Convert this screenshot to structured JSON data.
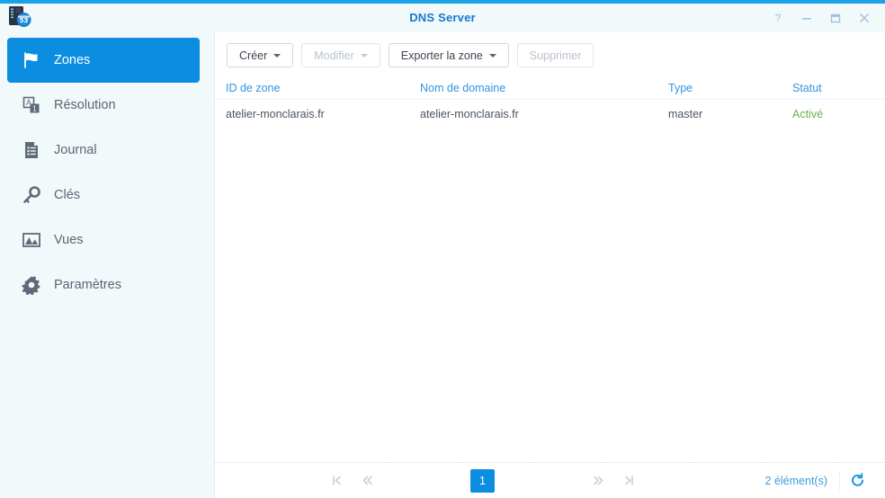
{
  "window": {
    "title": "DNS Server",
    "app_icon": "dns-server-icon",
    "accent_color": "#1ba1e6",
    "controls": [
      {
        "name": "help-button",
        "glyph": "?"
      },
      {
        "name": "minimize-button",
        "glyph": "minimize-icon"
      },
      {
        "name": "maximize-button",
        "glyph": "maximize-icon"
      },
      {
        "name": "close-button",
        "glyph": "close-icon"
      }
    ]
  },
  "sidebar": {
    "items": [
      {
        "label": "Zones",
        "icon": "flag-icon",
        "selected": true
      },
      {
        "label": "Résolution",
        "icon": "resolution-icon",
        "selected": false
      },
      {
        "label": "Journal",
        "icon": "document-list-icon",
        "selected": false
      },
      {
        "label": "Clés",
        "icon": "key-icon",
        "selected": false
      },
      {
        "label": "Vues",
        "icon": "image-icon",
        "selected": false
      },
      {
        "label": "Paramètres",
        "icon": "gear-icon",
        "selected": false
      }
    ]
  },
  "toolbar": {
    "buttons": [
      {
        "label": "Créer",
        "has_caret": true,
        "disabled": false
      },
      {
        "label": "Modifier",
        "has_caret": true,
        "disabled": true
      },
      {
        "label": "Exporter la zone",
        "has_caret": true,
        "disabled": false
      },
      {
        "label": "Supprimer",
        "has_caret": false,
        "disabled": true
      }
    ]
  },
  "table": {
    "columns": [
      {
        "key": "id",
        "label": "ID de zone"
      },
      {
        "key": "domain",
        "label": "Nom de domaine"
      },
      {
        "key": "type",
        "label": "Type"
      },
      {
        "key": "status",
        "label": "Statut"
      }
    ],
    "rows": [
      {
        "id": "atelier-monclarais.fr",
        "domain": "atelier-monclarais.fr",
        "type": "master",
        "status": "Activé",
        "status_color": "#66b446"
      }
    ]
  },
  "footer": {
    "first_page_icon": "first-page-icon",
    "prev_page_icon": "previous-page-icon",
    "current_page": "1",
    "next_page_icon": "next-page-icon",
    "last_page_icon": "last-page-icon",
    "item_count": "2 élément(s)",
    "refresh_icon": "refresh-icon"
  }
}
